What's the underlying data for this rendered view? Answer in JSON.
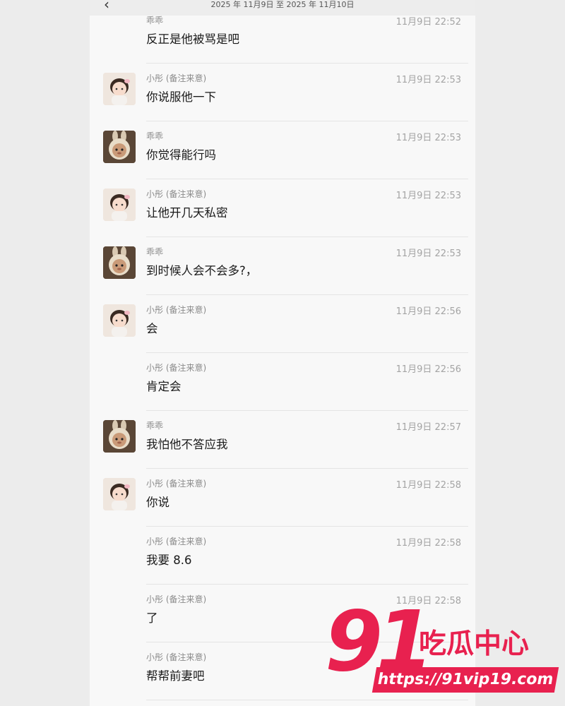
{
  "header": {
    "date_range": "2025 年 11月9日 至 2025 年 11月10日"
  },
  "messages": [
    {
      "sender": "乖乖",
      "time": "11月9日 22:52",
      "text": "反正是他被骂是吧",
      "avatar": "none"
    },
    {
      "sender": "小彤 (备注来意)",
      "time": "11月9日 22:53",
      "text": "你说服他一下",
      "avatar": "girl"
    },
    {
      "sender": "乖乖",
      "time": "11月9日 22:53",
      "text": "你觉得能行吗",
      "avatar": "bunny"
    },
    {
      "sender": "小彤 (备注来意)",
      "time": "11月9日 22:53",
      "text": "让他开几天私密",
      "avatar": "girl"
    },
    {
      "sender": "乖乖",
      "time": "11月9日 22:53",
      "text": "到时候人会不会多?，",
      "avatar": "bunny"
    },
    {
      "sender": "小彤 (备注来意)",
      "time": "11月9日 22:56",
      "text": "会",
      "avatar": "girl"
    },
    {
      "sender": "小彤 (备注来意)",
      "time": "11月9日 22:56",
      "text": "肯定会",
      "avatar": "none"
    },
    {
      "sender": "乖乖",
      "time": "11月9日 22:57",
      "text": "我怕他不答应我",
      "avatar": "bunny"
    },
    {
      "sender": "小彤 (备注来意)",
      "time": "11月9日 22:58",
      "text": "你说",
      "avatar": "girl"
    },
    {
      "sender": "小彤 (备注来意)",
      "time": "11月9日 22:58",
      "text": "我要 8.6",
      "avatar": "none"
    },
    {
      "sender": "小彤 (备注来意)",
      "time": "11月9日 22:58",
      "text": "了",
      "avatar": "none"
    },
    {
      "sender": "小彤 (备注来意)",
      "time": "",
      "text": "帮帮前妻吧",
      "avatar": "none"
    }
  ],
  "watermark": {
    "number": "91",
    "title": "吃瓜中心",
    "url": "https://91vip19.com"
  }
}
